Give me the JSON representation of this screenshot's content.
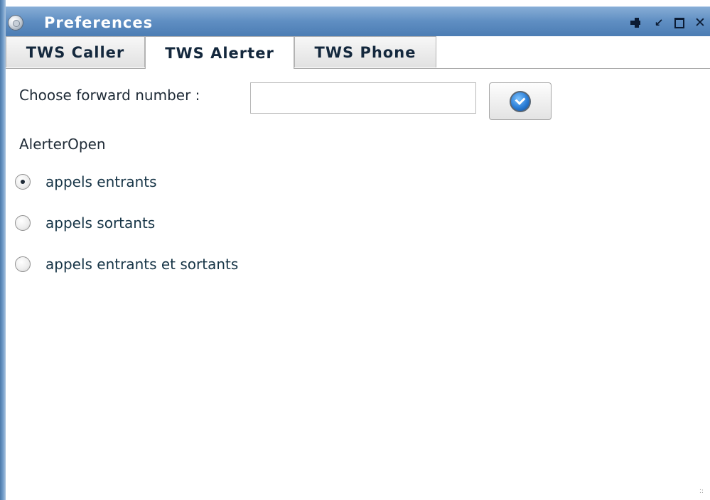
{
  "window": {
    "title": "Preferences",
    "controls": [
      "pin-icon",
      "minimize-icon",
      "maximize-icon",
      "close-icon"
    ]
  },
  "tabs": [
    {
      "label": "TWS Caller",
      "active": false
    },
    {
      "label": "TWS Alerter",
      "active": true
    },
    {
      "label": "TWS Phone",
      "active": false
    }
  ],
  "form": {
    "forward_label": "Choose forward number :",
    "forward_value": "",
    "forward_placeholder": "",
    "submit_icon": "check-icon",
    "section_label": "AlerterOpen",
    "options": [
      {
        "label": "appels entrants",
        "checked": true
      },
      {
        "label": "appels sortants",
        "checked": false
      },
      {
        "label": "appels entrants et sortants",
        "checked": false
      }
    ]
  },
  "colors": {
    "titlebar": "#5f8ec2",
    "title_text": "#ffffff",
    "text": "#1e2a36"
  }
}
